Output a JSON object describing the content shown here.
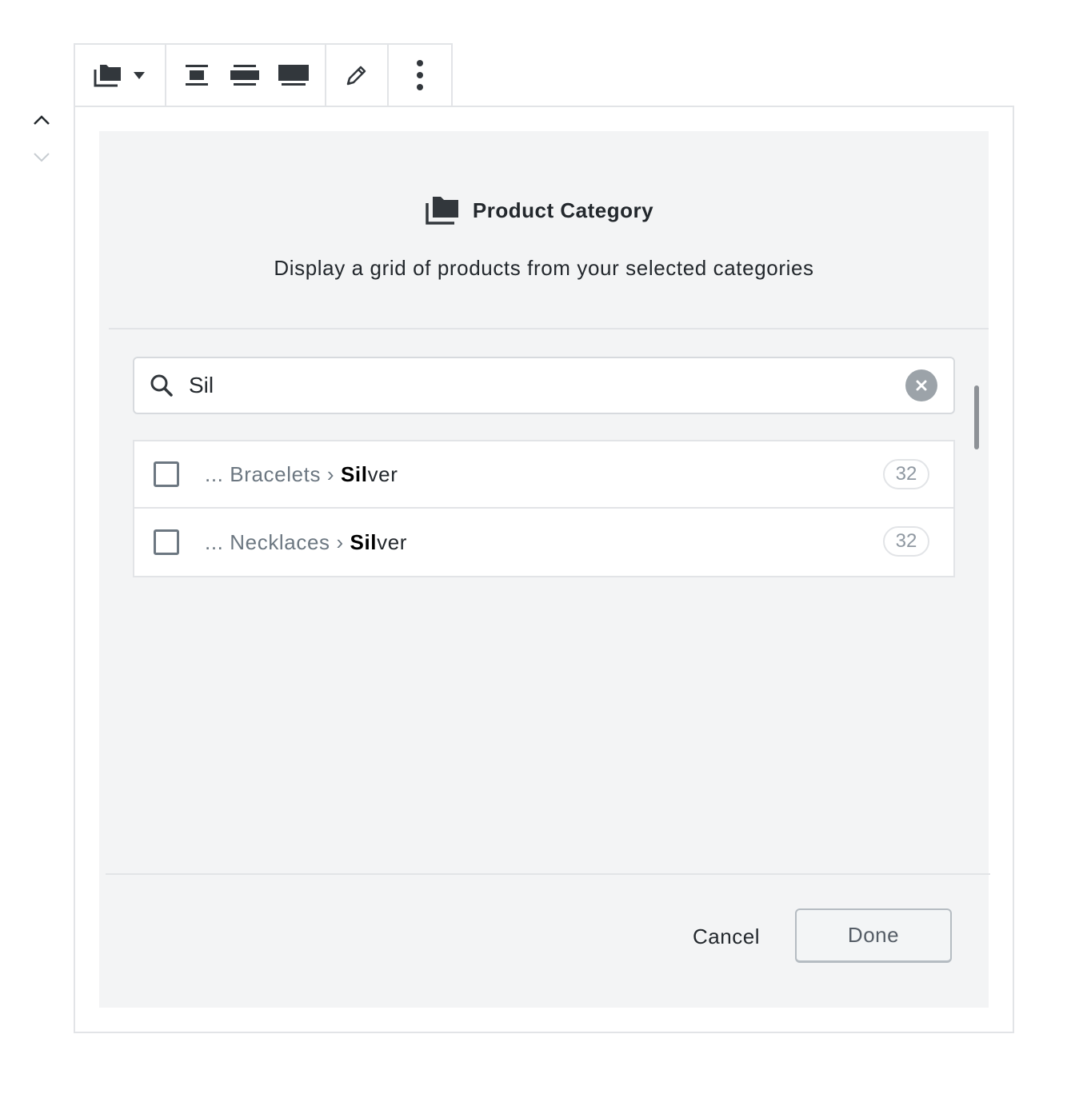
{
  "toolbar": {
    "block_type_icon": "folder-icon",
    "alignment_icons": [
      "align-wide-center-icon",
      "align-wide-icon",
      "align-full-icon"
    ],
    "edit_icon": "pencil-icon",
    "more_icon": "vertical-ellipsis-icon"
  },
  "block": {
    "title": "Product Category",
    "description": "Display a grid of products from your selected categories"
  },
  "search": {
    "value": "Sil",
    "placeholder": ""
  },
  "results": [
    {
      "crumb": "... Bracelets ›",
      "match": "Sil",
      "rest": "ver",
      "count": "32"
    },
    {
      "crumb": "... Necklaces ›",
      "match": "Sil",
      "rest": "ver",
      "count": "32"
    }
  ],
  "footer": {
    "cancel_label": "Cancel",
    "done_label": "Done"
  },
  "colors": {
    "placeholder_bg": "#f3f4f5",
    "border": "#e2e4e7",
    "text": "#23282d",
    "muted": "#6c7781"
  }
}
